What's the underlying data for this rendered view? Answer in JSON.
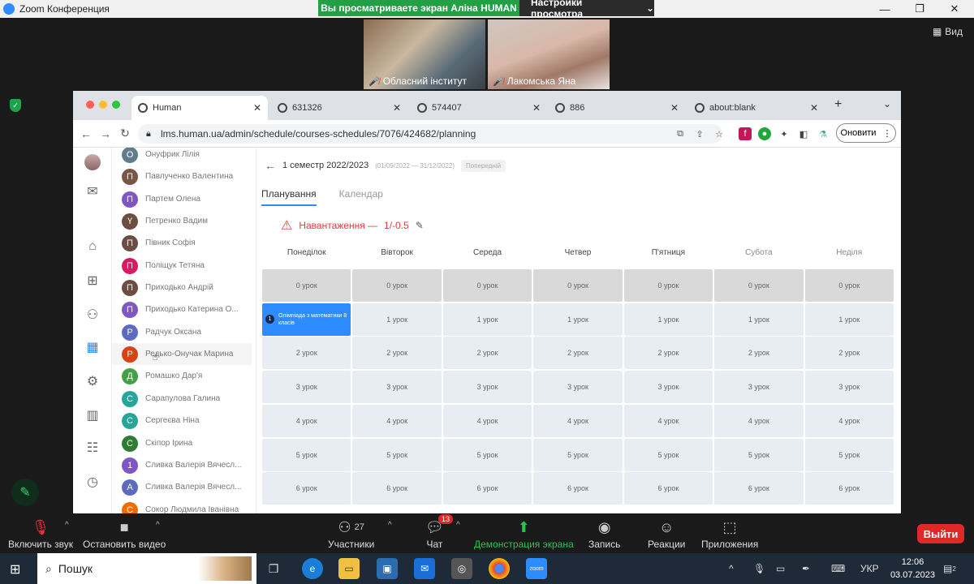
{
  "zoom": {
    "title": "Zoom Конференция",
    "banner_text": "Вы просматриваете экран Аліна HUMAN",
    "view_settings": "Настройки просмотра",
    "view_button": "Вид",
    "participants_video": [
      {
        "name": "Обласний інститут"
      },
      {
        "name": "Лакомська Яна"
      }
    ],
    "toolbar": {
      "mute": "Включить звук",
      "video": "Остановить видео",
      "participants": "Участники",
      "participants_count": "27",
      "chat": "Чат",
      "chat_badge": "13",
      "share": "Демонстрация экрана",
      "record": "Запись",
      "reactions": "Реакции",
      "apps": "Приложения",
      "exit": "Выйти"
    }
  },
  "browser": {
    "tabs": [
      {
        "label": "Human"
      },
      {
        "label": "631326"
      },
      {
        "label": "574407"
      },
      {
        "label": "886"
      },
      {
        "label": "about:blank"
      }
    ],
    "url": "lms.human.ua/admin/schedule/courses-schedules/7076/424682/planning",
    "refresh_button": "Оновити"
  },
  "users": [
    {
      "initial": "О",
      "name": "Онуфрик Лілія",
      "color": "#607d8b"
    },
    {
      "initial": "П",
      "name": "Павлученко Валентина",
      "color": "#795548"
    },
    {
      "initial": "П",
      "name": "Партем Олена",
      "color": "#7e57c2"
    },
    {
      "initial": "Ү",
      "name": "Петренко Вадим",
      "color": "#6d4c41"
    },
    {
      "initial": "П",
      "name": "Півник Софія",
      "color": "#6d4c41"
    },
    {
      "initial": "П",
      "name": "Поліщук Тетяна",
      "color": "#d81b60"
    },
    {
      "initial": "П",
      "name": "Приходько Андрій",
      "color": "#6d4c41"
    },
    {
      "initial": "П",
      "name": "Приходько Катерина О...",
      "color": "#7e57c2"
    },
    {
      "initial": "Р",
      "name": "Радчук Оксана",
      "color": "#5c6bc0"
    },
    {
      "initial": "Р",
      "name": "Редько-Онучак Марина",
      "color": "#d84315"
    },
    {
      "initial": "Д",
      "name": "Ромашко Дар'я",
      "color": "#43a047"
    },
    {
      "initial": "С",
      "name": "Сарапулова Галина",
      "color": "#26a69a"
    },
    {
      "initial": "С",
      "name": "Сергеєва Ніна",
      "color": "#26a69a"
    },
    {
      "initial": "С",
      "name": "Скіпор Ірина",
      "color": "#2e7d32"
    },
    {
      "initial": "1",
      "name": "Сливка Валерія Вячесл...",
      "color": "#7e57c2"
    },
    {
      "initial": "А",
      "name": "Сливка Валерія Вячесл...",
      "color": "#5c6bc0"
    },
    {
      "initial": "С",
      "name": "Сокор Людмила Іванівна",
      "color": "#ef6c00"
    }
  ],
  "schedule": {
    "semester": "1 семестр 2022/2023",
    "dates": "(01/09/2022 — 31/12/2022)",
    "badge": "Попередній",
    "tab_planning": "Планування",
    "tab_calendar": "Календар",
    "load_label": "Навантаження —",
    "load_value": "1/-0.5",
    "days": [
      "Понеділок",
      "Вівторок",
      "Середа",
      "Четвер",
      "П'ятниця",
      "Субота",
      "Неділя"
    ],
    "lessons": [
      "0 урок",
      "1 урок",
      "2 урок",
      "3 урок",
      "4 урок",
      "5 урок",
      "6 урок"
    ],
    "booked": {
      "num": "1",
      "text": "Олімпіада з математики 8 класів"
    }
  },
  "taskbar": {
    "search": "Пошук",
    "lang": "УКР",
    "time": "12:06",
    "date": "03.07.2023",
    "notif_count": "2"
  }
}
